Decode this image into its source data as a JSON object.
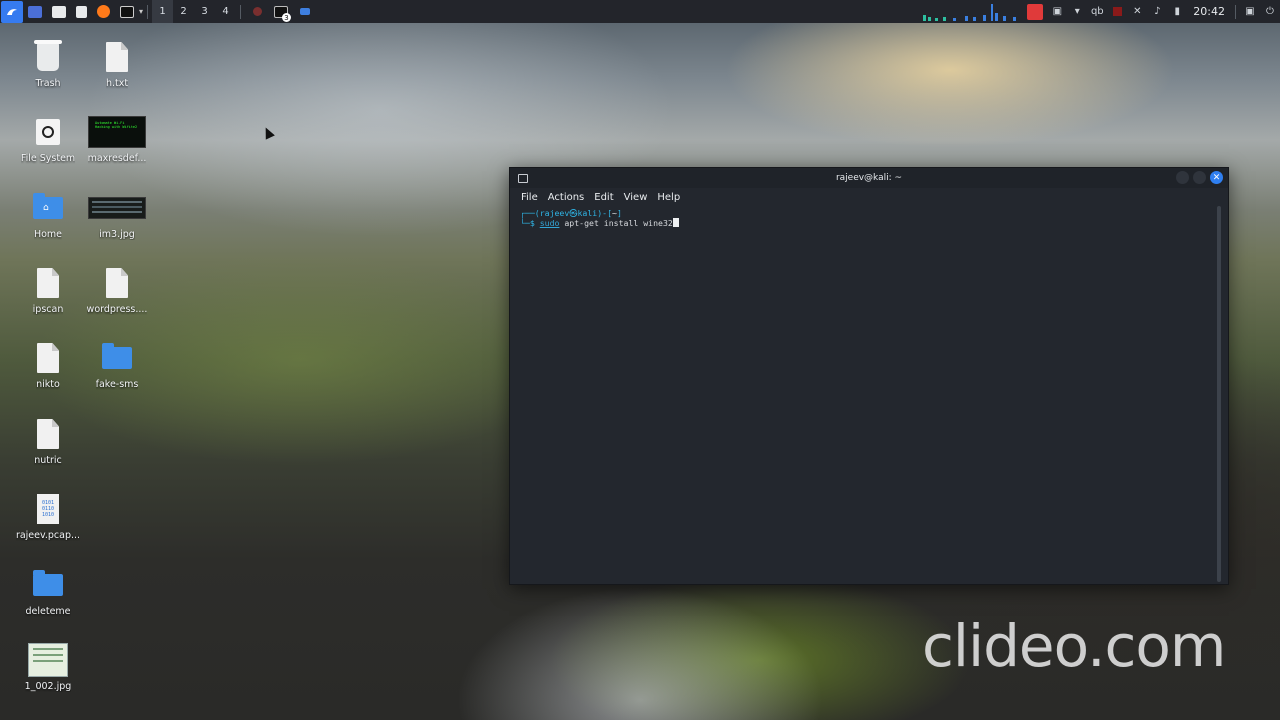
{
  "panel": {
    "workspaces": [
      "1",
      "2",
      "3",
      "4"
    ],
    "badge": "3",
    "tray_misc": "qb",
    "clock": "20:42",
    "colors": {
      "panel_bg": "#23252b",
      "accent": "#367bf0",
      "record": "#e03a3a"
    }
  },
  "desktop": {
    "icons": [
      {
        "label": "Trash",
        "icon": "trash-icon"
      },
      {
        "label": "h.txt",
        "icon": "file-icon"
      },
      {
        "label": "File System",
        "icon": "drive-icon"
      },
      {
        "label": "maxresdef...",
        "icon": "image-thumbnail"
      },
      {
        "label": "Home",
        "icon": "home-folder-icon"
      },
      {
        "label": "im3.jpg",
        "icon": "image-thumbnail"
      },
      {
        "label": "ipscan",
        "icon": "file-icon"
      },
      {
        "label": "wordpress....",
        "icon": "file-icon"
      },
      {
        "label": "nikto",
        "icon": "file-icon"
      },
      {
        "label": "fake-sms",
        "icon": "folder-icon"
      },
      {
        "label": "nutric",
        "icon": "file-icon"
      },
      {
        "label": "rajeev.pcap...",
        "icon": "pcap-file-icon"
      },
      {
        "label": "deleteme",
        "icon": "folder-icon"
      },
      {
        "label": "1_002.jpg",
        "icon": "image-thumbnail"
      }
    ],
    "thumb_text": "Automate Wi-Fi Hacking with Wifite2",
    "pcap_text": "0101 0110 1010"
  },
  "terminal": {
    "title": "rajeev@kali: ~",
    "menu": [
      "File",
      "Actions",
      "Edit",
      "View",
      "Help"
    ],
    "prompt_open": "┌──(",
    "user": "rajeev",
    "at": "㉿",
    "host": "kali",
    "prompt_mid": ")-[",
    "dir": "~",
    "prompt_close": "]",
    "prompt_line2": "└─$ ",
    "cmd_sudo": "sudo",
    "cmd_rest": " apt-get install wine32",
    "colors": {
      "bg": "#23272e",
      "prompt": "#2fb5e6",
      "close_btn": "#2f7ff0"
    }
  },
  "watermark": "clideo.com"
}
